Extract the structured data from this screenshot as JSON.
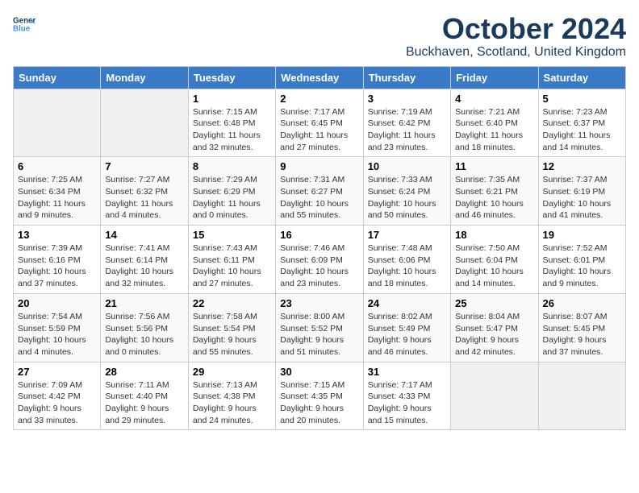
{
  "logo": {
    "line1": "General",
    "line2": "Blue"
  },
  "title": "October 2024",
  "location": "Buckhaven, Scotland, United Kingdom",
  "weekdays": [
    "Sunday",
    "Monday",
    "Tuesday",
    "Wednesday",
    "Thursday",
    "Friday",
    "Saturday"
  ],
  "weeks": [
    [
      {
        "day": "",
        "sunrise": "",
        "sunset": "",
        "daylight": ""
      },
      {
        "day": "",
        "sunrise": "",
        "sunset": "",
        "daylight": ""
      },
      {
        "day": "1",
        "sunrise": "Sunrise: 7:15 AM",
        "sunset": "Sunset: 6:48 PM",
        "daylight": "Daylight: 11 hours and 32 minutes."
      },
      {
        "day": "2",
        "sunrise": "Sunrise: 7:17 AM",
        "sunset": "Sunset: 6:45 PM",
        "daylight": "Daylight: 11 hours and 27 minutes."
      },
      {
        "day": "3",
        "sunrise": "Sunrise: 7:19 AM",
        "sunset": "Sunset: 6:42 PM",
        "daylight": "Daylight: 11 hours and 23 minutes."
      },
      {
        "day": "4",
        "sunrise": "Sunrise: 7:21 AM",
        "sunset": "Sunset: 6:40 PM",
        "daylight": "Daylight: 11 hours and 18 minutes."
      },
      {
        "day": "5",
        "sunrise": "Sunrise: 7:23 AM",
        "sunset": "Sunset: 6:37 PM",
        "daylight": "Daylight: 11 hours and 14 minutes."
      }
    ],
    [
      {
        "day": "6",
        "sunrise": "Sunrise: 7:25 AM",
        "sunset": "Sunset: 6:34 PM",
        "daylight": "Daylight: 11 hours and 9 minutes."
      },
      {
        "day": "7",
        "sunrise": "Sunrise: 7:27 AM",
        "sunset": "Sunset: 6:32 PM",
        "daylight": "Daylight: 11 hours and 4 minutes."
      },
      {
        "day": "8",
        "sunrise": "Sunrise: 7:29 AM",
        "sunset": "Sunset: 6:29 PM",
        "daylight": "Daylight: 11 hours and 0 minutes."
      },
      {
        "day": "9",
        "sunrise": "Sunrise: 7:31 AM",
        "sunset": "Sunset: 6:27 PM",
        "daylight": "Daylight: 10 hours and 55 minutes."
      },
      {
        "day": "10",
        "sunrise": "Sunrise: 7:33 AM",
        "sunset": "Sunset: 6:24 PM",
        "daylight": "Daylight: 10 hours and 50 minutes."
      },
      {
        "day": "11",
        "sunrise": "Sunrise: 7:35 AM",
        "sunset": "Sunset: 6:21 PM",
        "daylight": "Daylight: 10 hours and 46 minutes."
      },
      {
        "day": "12",
        "sunrise": "Sunrise: 7:37 AM",
        "sunset": "Sunset: 6:19 PM",
        "daylight": "Daylight: 10 hours and 41 minutes."
      }
    ],
    [
      {
        "day": "13",
        "sunrise": "Sunrise: 7:39 AM",
        "sunset": "Sunset: 6:16 PM",
        "daylight": "Daylight: 10 hours and 37 minutes."
      },
      {
        "day": "14",
        "sunrise": "Sunrise: 7:41 AM",
        "sunset": "Sunset: 6:14 PM",
        "daylight": "Daylight: 10 hours and 32 minutes."
      },
      {
        "day": "15",
        "sunrise": "Sunrise: 7:43 AM",
        "sunset": "Sunset: 6:11 PM",
        "daylight": "Daylight: 10 hours and 27 minutes."
      },
      {
        "day": "16",
        "sunrise": "Sunrise: 7:46 AM",
        "sunset": "Sunset: 6:09 PM",
        "daylight": "Daylight: 10 hours and 23 minutes."
      },
      {
        "day": "17",
        "sunrise": "Sunrise: 7:48 AM",
        "sunset": "Sunset: 6:06 PM",
        "daylight": "Daylight: 10 hours and 18 minutes."
      },
      {
        "day": "18",
        "sunrise": "Sunrise: 7:50 AM",
        "sunset": "Sunset: 6:04 PM",
        "daylight": "Daylight: 10 hours and 14 minutes."
      },
      {
        "day": "19",
        "sunrise": "Sunrise: 7:52 AM",
        "sunset": "Sunset: 6:01 PM",
        "daylight": "Daylight: 10 hours and 9 minutes."
      }
    ],
    [
      {
        "day": "20",
        "sunrise": "Sunrise: 7:54 AM",
        "sunset": "Sunset: 5:59 PM",
        "daylight": "Daylight: 10 hours and 4 minutes."
      },
      {
        "day": "21",
        "sunrise": "Sunrise: 7:56 AM",
        "sunset": "Sunset: 5:56 PM",
        "daylight": "Daylight: 10 hours and 0 minutes."
      },
      {
        "day": "22",
        "sunrise": "Sunrise: 7:58 AM",
        "sunset": "Sunset: 5:54 PM",
        "daylight": "Daylight: 9 hours and 55 minutes."
      },
      {
        "day": "23",
        "sunrise": "Sunrise: 8:00 AM",
        "sunset": "Sunset: 5:52 PM",
        "daylight": "Daylight: 9 hours and 51 minutes."
      },
      {
        "day": "24",
        "sunrise": "Sunrise: 8:02 AM",
        "sunset": "Sunset: 5:49 PM",
        "daylight": "Daylight: 9 hours and 46 minutes."
      },
      {
        "day": "25",
        "sunrise": "Sunrise: 8:04 AM",
        "sunset": "Sunset: 5:47 PM",
        "daylight": "Daylight: 9 hours and 42 minutes."
      },
      {
        "day": "26",
        "sunrise": "Sunrise: 8:07 AM",
        "sunset": "Sunset: 5:45 PM",
        "daylight": "Daylight: 9 hours and 37 minutes."
      }
    ],
    [
      {
        "day": "27",
        "sunrise": "Sunrise: 7:09 AM",
        "sunset": "Sunset: 4:42 PM",
        "daylight": "Daylight: 9 hours and 33 minutes."
      },
      {
        "day": "28",
        "sunrise": "Sunrise: 7:11 AM",
        "sunset": "Sunset: 4:40 PM",
        "daylight": "Daylight: 9 hours and 29 minutes."
      },
      {
        "day": "29",
        "sunrise": "Sunrise: 7:13 AM",
        "sunset": "Sunset: 4:38 PM",
        "daylight": "Daylight: 9 hours and 24 minutes."
      },
      {
        "day": "30",
        "sunrise": "Sunrise: 7:15 AM",
        "sunset": "Sunset: 4:35 PM",
        "daylight": "Daylight: 9 hours and 20 minutes."
      },
      {
        "day": "31",
        "sunrise": "Sunrise: 7:17 AM",
        "sunset": "Sunset: 4:33 PM",
        "daylight": "Daylight: 9 hours and 15 minutes."
      },
      {
        "day": "",
        "sunrise": "",
        "sunset": "",
        "daylight": ""
      },
      {
        "day": "",
        "sunrise": "",
        "sunset": "",
        "daylight": ""
      }
    ]
  ]
}
